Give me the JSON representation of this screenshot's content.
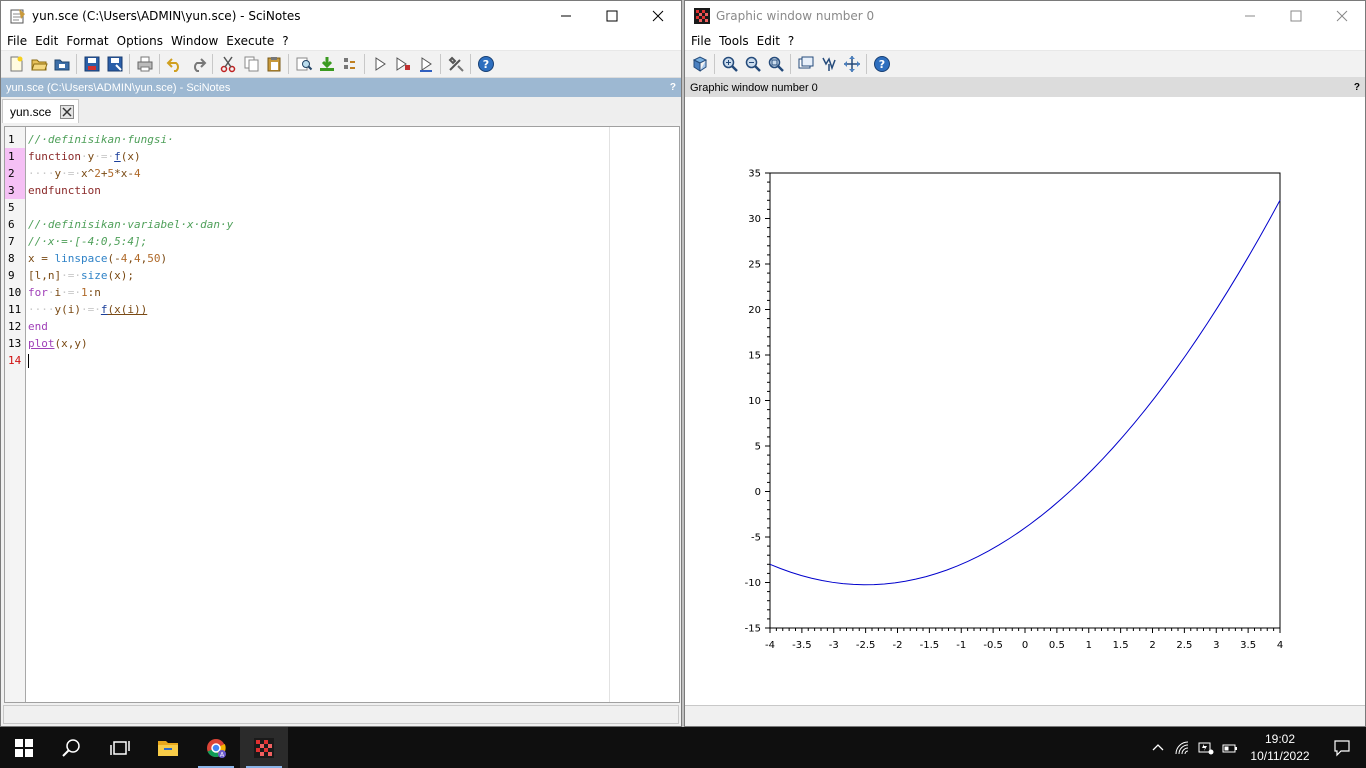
{
  "scinotes": {
    "title": "yun.sce (C:\\Users\\ADMIN\\yun.sce) - SciNotes",
    "menu": [
      "File",
      "Edit",
      "Format",
      "Options",
      "Window",
      "Execute",
      "?"
    ],
    "toolbar_icons": [
      "new-file-icon",
      "open-file-icon",
      "open-folder-icon",
      "save-icon",
      "save-as-icon",
      "print-icon",
      "undo-icon",
      "redo-icon",
      "cut-icon",
      "copy-icon",
      "paste-icon",
      "find-icon",
      "load-execute-icon",
      "execute-icon",
      "run-icon",
      "run-to-icon",
      "run-from-icon",
      "settings-icon",
      "help-icon"
    ],
    "doc_bar": "yun.sce (C:\\Users\\ADMIN\\yun.sce) - SciNotes",
    "doc_bar_help": "?",
    "tab_label": "yun.sce",
    "line_numbers": [
      "1",
      "1",
      "2",
      "3",
      "5",
      "6",
      "7",
      "8",
      "9",
      "10",
      "11",
      "12",
      "13",
      "14"
    ],
    "code_lines": [
      [
        {
          "t": "//·definisikan·fungsi·",
          "c": "k-com"
        }
      ],
      [
        {
          "t": "function",
          "c": "k-kw"
        },
        {
          "t": "·",
          "c": "k-dot"
        },
        {
          "t": "y",
          "c": "k-var"
        },
        {
          "t": "·=·",
          "c": "k-dot"
        },
        {
          "t": "f",
          "c": "k-fn"
        },
        {
          "t": "(x)",
          "c": "k-var"
        }
      ],
      [
        {
          "t": "····",
          "c": "k-dot"
        },
        {
          "t": "y",
          "c": "k-var"
        },
        {
          "t": "·=·",
          "c": "k-dot"
        },
        {
          "t": "x^",
          "c": "k-var"
        },
        {
          "t": "2",
          "c": "k-num"
        },
        {
          "t": "+",
          "c": "k-var"
        },
        {
          "t": "5",
          "c": "k-num"
        },
        {
          "t": "*x-",
          "c": "k-var"
        },
        {
          "t": "4",
          "c": "k-num"
        }
      ],
      [
        {
          "t": "endfunction",
          "c": "k-kw"
        }
      ],
      [
        {
          "t": "",
          "c": "k-var"
        }
      ],
      [
        {
          "t": "//·definisikan·variabel·x·dan·y",
          "c": "k-com"
        }
      ],
      [
        {
          "t": "//·x·=·[-4:0,5:4];",
          "c": "k-com"
        }
      ],
      [
        {
          "t": "x",
          "c": "k-var"
        },
        {
          "t": " = ",
          "c": "k-var"
        },
        {
          "t": "linspace",
          "c": "k-bi"
        },
        {
          "t": "(-",
          "c": "k-var"
        },
        {
          "t": "4",
          "c": "k-num"
        },
        {
          "t": ",",
          "c": "k-var"
        },
        {
          "t": "4",
          "c": "k-num"
        },
        {
          "t": ",",
          "c": "k-var"
        },
        {
          "t": "50",
          "c": "k-num"
        },
        {
          "t": ")",
          "c": "k-var"
        }
      ],
      [
        {
          "t": "[l,n]",
          "c": "k-var"
        },
        {
          "t": "·=·",
          "c": "k-dot"
        },
        {
          "t": "size",
          "c": "k-bi"
        },
        {
          "t": "(x);",
          "c": "k-var"
        }
      ],
      [
        {
          "t": "for",
          "c": "k-ctrl"
        },
        {
          "t": "·",
          "c": "k-dot"
        },
        {
          "t": "i",
          "c": "k-var"
        },
        {
          "t": "·=·",
          "c": "k-dot"
        },
        {
          "t": "1",
          "c": "k-num"
        },
        {
          "t": ":",
          "c": "k-var"
        },
        {
          "t": "n",
          "c": "k-var"
        }
      ],
      [
        {
          "t": "····",
          "c": "k-dot"
        },
        {
          "t": "y(i)",
          "c": "k-var"
        },
        {
          "t": "·=·",
          "c": "k-dot"
        },
        {
          "t": "f",
          "c": "k-fn"
        },
        {
          "t": "(x(i))",
          "c": "k-var"
        }
      ],
      [
        {
          "t": "end",
          "c": "k-ctrl"
        }
      ],
      [
        {
          "t": "plot",
          "c": "k-ctrl"
        },
        {
          "t": "(x,y)",
          "c": "k-var"
        }
      ],
      [
        {
          "t": "",
          "c": "k-var"
        }
      ]
    ]
  },
  "graphic": {
    "title": "Graphic window number 0",
    "menu": [
      "File",
      "Tools",
      "Edit",
      "?"
    ],
    "toolbar_icons": [
      "rotate-icon",
      "zoom-in-icon",
      "zoom-out-icon",
      "zoom-fit-icon",
      "datatip-icon",
      "edit-curve-icon",
      "pan-icon",
      "help-icon"
    ],
    "doc_bar": "Graphic window number 0",
    "doc_bar_help": "?"
  },
  "chart_data": {
    "type": "line",
    "function": "y = x^2 + 5*x - 4",
    "x_range": [
      -4,
      4
    ],
    "points": 50,
    "xlim": [
      -4,
      4
    ],
    "ylim": [
      -15,
      35
    ],
    "xticks": [
      "-4",
      "-3.5",
      "-3",
      "-2.5",
      "-2",
      "-1.5",
      "-1",
      "-0.5",
      "0",
      "0.5",
      "1",
      "1.5",
      "2",
      "2.5",
      "3",
      "3.5",
      "4"
    ],
    "yticks": [
      "35",
      "30",
      "25",
      "20",
      "15",
      "10",
      "5",
      "0",
      "-5",
      "-10",
      "-15"
    ],
    "series": [
      {
        "color": "#0000cc",
        "x": [
          -4,
          -3,
          -2.5,
          -2,
          -1,
          0,
          1,
          2,
          3,
          4
        ],
        "y": [
          -8,
          -10,
          -10.25,
          -10,
          -8,
          -4,
          2,
          10,
          20,
          32
        ]
      }
    ],
    "grid": false,
    "title": "",
    "xlabel": "",
    "ylabel": ""
  },
  "taskbar": {
    "time": "19:02",
    "date": "10/11/2022",
    "apps": [
      "start-icon",
      "search-icon",
      "task-view-icon",
      "file-explorer-icon",
      "chrome-icon",
      "scilab-icon"
    ]
  }
}
